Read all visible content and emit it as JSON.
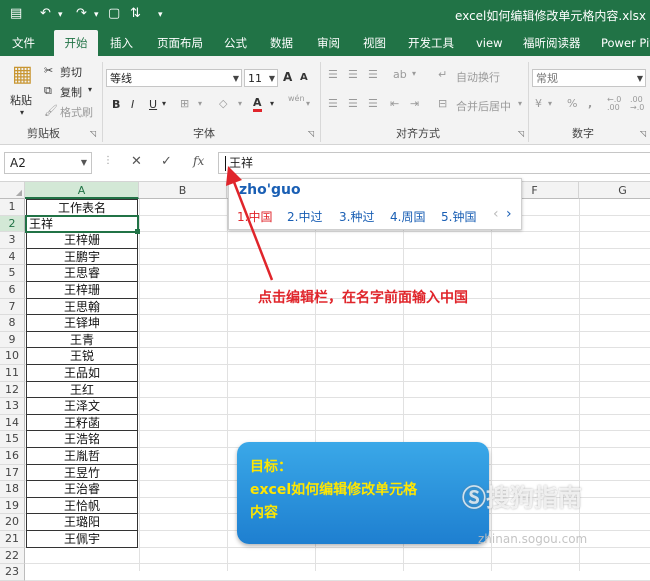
{
  "window": {
    "title": "excel如何编辑修改单元格内容.xlsx",
    "quick_access": [
      "save-icon",
      "undo-icon",
      "redo-icon",
      "print-preview-icon",
      "sort-icon",
      "customize-icon"
    ]
  },
  "tabs": [
    "文件",
    "开始",
    "插入",
    "页面布局",
    "公式",
    "数据",
    "审阅",
    "视图",
    "开发工具",
    "view",
    "福昕阅读器",
    "Power Piv"
  ],
  "active_tab": "开始",
  "ribbon": {
    "clipboard": {
      "paste": "粘贴",
      "cut": "剪切",
      "copy": "复制",
      "format_painter": "格式刷",
      "group": "剪贴板"
    },
    "font": {
      "name": "等线",
      "size": "11",
      "bold": "B",
      "italic": "I",
      "underline": "U",
      "grow": "A",
      "shrink": "A",
      "font_color": "A",
      "wen": "wén",
      "group": "字体"
    },
    "alignment": {
      "wrap": "自动换行",
      "merge": "合并后居中",
      "group": "对齐方式"
    },
    "number": {
      "format": "常规",
      "percent": "%",
      "comma": ",",
      "inc": "←.0 .00",
      "dec": ".00 →.0",
      "group": "数字"
    }
  },
  "formula_bar": {
    "name_box": "A2",
    "cancel": "✕",
    "enter": "✓",
    "fx": "fx",
    "value": "王祥"
  },
  "columns": [
    "A",
    "B",
    "C",
    "D",
    "E",
    "F",
    "G"
  ],
  "rows": [
    "1",
    "2",
    "3",
    "4",
    "5",
    "6",
    "7",
    "8",
    "9",
    "10",
    "11",
    "12",
    "13",
    "14",
    "15",
    "16",
    "17",
    "18",
    "19",
    "20",
    "21",
    "22",
    "23"
  ],
  "cells_a": [
    "工作表名",
    "王祥",
    "王梓姗",
    "王鹏宇",
    "王思睿",
    "王梓珊",
    "王思翰",
    "王铎坤",
    "王青",
    "王锐",
    "王品如",
    "王红",
    "王泽文",
    "王籽菡",
    "王浩铭",
    "王胤哲",
    "王昱竹",
    "王治睿",
    "王恰帆",
    "王璐阳",
    "王佩宇"
  ],
  "ime": {
    "pinyin": "zho'guo",
    "candidates": [
      "1.中国",
      "2.中过",
      "3.种过",
      "4.周国",
      "5.钟国"
    ],
    "prev": "‹",
    "next": "›"
  },
  "annotation": "点击编辑栏，在名字前面输入中国",
  "goal": {
    "line1": "目标：",
    "line2": "excel如何编辑修改单元格",
    "line3": "内容"
  },
  "watermark": {
    "main": "搜狗指南",
    "sub": "zhinan.sogou.com"
  },
  "colors": {
    "excel_green": "#217346",
    "annotation_red": "#e0252b",
    "goal_yellow": "#ffe600",
    "goal_blue": "#2a93dc"
  }
}
